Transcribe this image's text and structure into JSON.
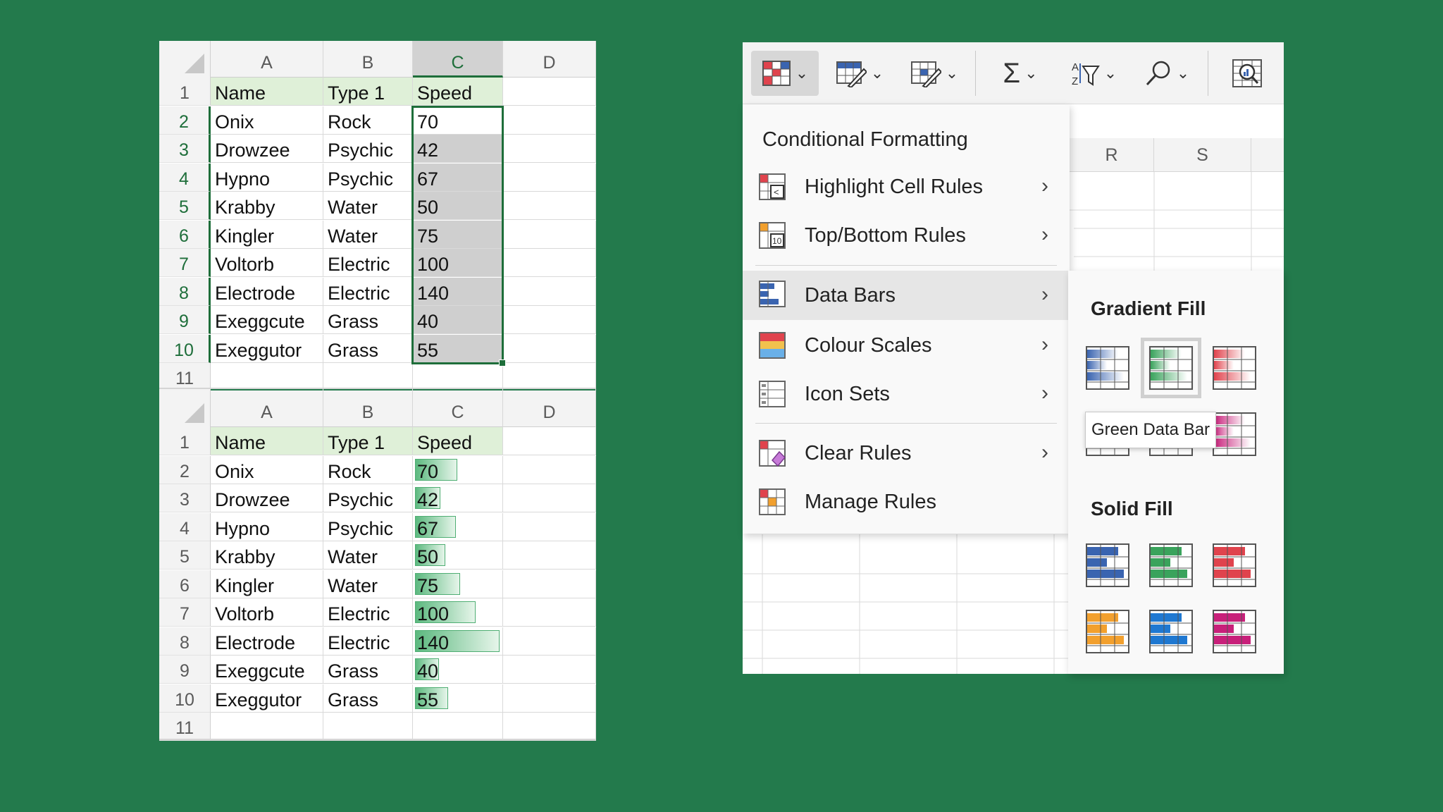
{
  "sheet1": {
    "columns": [
      "A",
      "B",
      "C",
      "D"
    ],
    "selected_column": "C",
    "header": {
      "row": "1",
      "name": "Name",
      "type": "Type 1",
      "speed": "Speed"
    },
    "rows": [
      {
        "row": "2",
        "name": "Onix",
        "type": "Rock",
        "speed": "70"
      },
      {
        "row": "3",
        "name": "Drowzee",
        "type": "Psychic",
        "speed": "42"
      },
      {
        "row": "4",
        "name": "Hypno",
        "type": "Psychic",
        "speed": "67"
      },
      {
        "row": "5",
        "name": "Krabby",
        "type": "Water",
        "speed": "50"
      },
      {
        "row": "6",
        "name": "Kingler",
        "type": "Water",
        "speed": "75"
      },
      {
        "row": "7",
        "name": "Voltorb",
        "type": "Electric",
        "speed": "100"
      },
      {
        "row": "8",
        "name": "Electrode",
        "type": "Electric",
        "speed": "140"
      },
      {
        "row": "9",
        "name": "Exeggcute",
        "type": "Grass",
        "speed": "40"
      },
      {
        "row": "10",
        "name": "Exeggutor",
        "type": "Grass",
        "speed": "55"
      }
    ],
    "last_row": "11"
  },
  "sheet2": {
    "columns": [
      "A",
      "B",
      "C",
      "D"
    ],
    "header": {
      "row": "1",
      "name": "Name",
      "type": "Type 1",
      "speed": "Speed"
    },
    "rows": [
      {
        "row": "2",
        "name": "Onix",
        "type": "Rock",
        "speed": "70",
        "bar_fraction": 0.5
      },
      {
        "row": "3",
        "name": "Drowzee",
        "type": "Psychic",
        "speed": "42",
        "bar_fraction": 0.3
      },
      {
        "row": "4",
        "name": "Hypno",
        "type": "Psychic",
        "speed": "67",
        "bar_fraction": 0.48
      },
      {
        "row": "5",
        "name": "Krabby",
        "type": "Water",
        "speed": "50",
        "bar_fraction": 0.357
      },
      {
        "row": "6",
        "name": "Kingler",
        "type": "Water",
        "speed": "75",
        "bar_fraction": 0.536
      },
      {
        "row": "7",
        "name": "Voltorb",
        "type": "Electric",
        "speed": "100",
        "bar_fraction": 0.714
      },
      {
        "row": "8",
        "name": "Electrode",
        "type": "Electric",
        "speed": "140",
        "bar_fraction": 1.0
      },
      {
        "row": "9",
        "name": "Exeggcute",
        "type": "Grass",
        "speed": "40",
        "bar_fraction": 0.286
      },
      {
        "row": "10",
        "name": "Exeggutor",
        "type": "Grass",
        "speed": "55",
        "bar_fraction": 0.393
      }
    ],
    "last_row": "11"
  },
  "ribbon": {
    "buttons": [
      {
        "icon": "conditional-formatting-icon",
        "active": true
      },
      {
        "icon": "format-as-table-icon"
      },
      {
        "icon": "cell-styles-icon"
      },
      {
        "icon": "autosum-icon"
      },
      {
        "icon": "sort-filter-icon"
      },
      {
        "icon": "find-select-icon"
      },
      {
        "icon": "analyze-data-icon"
      }
    ]
  },
  "background_sheet": {
    "columns": [
      "R",
      "S"
    ]
  },
  "menu": {
    "title": "Conditional Formatting",
    "items": [
      {
        "label": "Highlight Cell Rules",
        "icon": "highlight-cell-rules-icon",
        "has_submenu": true
      },
      {
        "label": "Top/Bottom Rules",
        "icon": "top-bottom-rules-icon",
        "has_submenu": true
      },
      {
        "label": "Data Bars",
        "icon": "data-bars-icon",
        "has_submenu": true,
        "highlighted": true
      },
      {
        "label": "Colour Scales",
        "icon": "colour-scales-icon",
        "has_submenu": true
      },
      {
        "label": "Icon Sets",
        "icon": "icon-sets-icon",
        "has_submenu": true
      },
      {
        "label": "Clear Rules",
        "icon": "clear-rules-icon",
        "has_submenu": true
      },
      {
        "label": "Manage Rules",
        "icon": "manage-rules-icon",
        "has_submenu": false
      }
    ]
  },
  "submenu": {
    "gradient_title": "Gradient Fill",
    "solid_title": "Solid Fill",
    "gradient_colors": [
      "#3a64b0",
      "#3aa35c",
      "#e0434d",
      "#f2a02e",
      "#1f78d1",
      "#c8207a"
    ],
    "solid_colors": [
      "#3a64b0",
      "#3aa35c",
      "#e0434d",
      "#f2a02e",
      "#1f78d1",
      "#c8207a"
    ],
    "selected": "Green Data Bar",
    "tooltip": "Green Data Bar"
  },
  "colors": {
    "background": "#237a4c",
    "selection": "#1e6e3a",
    "header_fill": "#dff0d8",
    "bar": "#5cb97f"
  }
}
